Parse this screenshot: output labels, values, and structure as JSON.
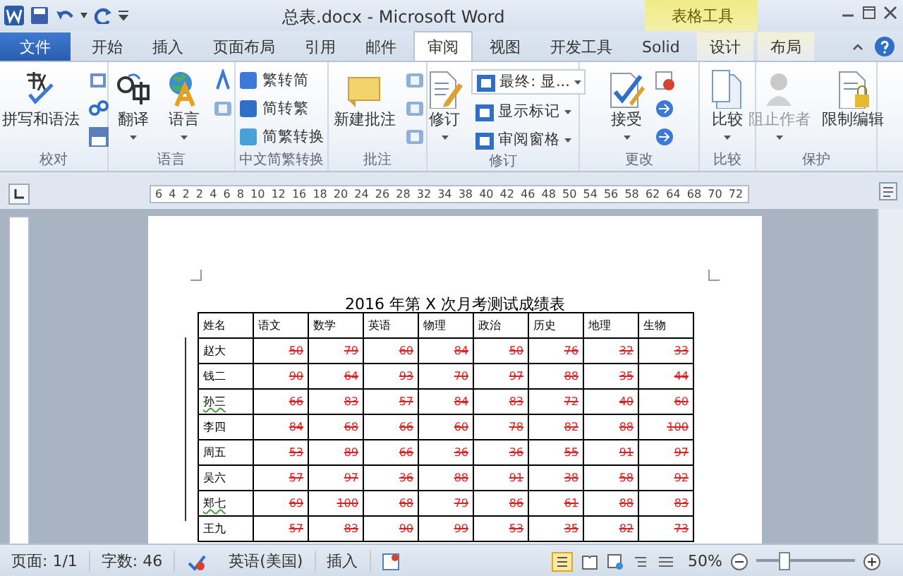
{
  "window": {
    "title": "总表.docx - Microsoft Word",
    "contextual_group": "表格工具"
  },
  "tabs": [
    {
      "label": "文件",
      "kind": "file",
      "selected": false
    },
    {
      "label": "开始",
      "kind": "normal",
      "selected": false
    },
    {
      "label": "插入",
      "kind": "normal",
      "selected": false
    },
    {
      "label": "页面布局",
      "kind": "normal",
      "selected": false
    },
    {
      "label": "引用",
      "kind": "normal",
      "selected": false
    },
    {
      "label": "邮件",
      "kind": "normal",
      "selected": false
    },
    {
      "label": "审阅",
      "kind": "normal",
      "selected": true
    },
    {
      "label": "视图",
      "kind": "normal",
      "selected": false
    },
    {
      "label": "开发工具",
      "kind": "normal",
      "selected": false
    },
    {
      "label": "Solid",
      "kind": "normal",
      "selected": false
    },
    {
      "label": "设计",
      "kind": "contextual",
      "selected": false
    },
    {
      "label": "布局",
      "kind": "contextual",
      "selected": false
    }
  ],
  "ribbon_groups": [
    {
      "title": "校对",
      "items": [
        {
          "kind": "large",
          "label": "拼写和语法",
          "dropdown": false,
          "disabled": false
        },
        {
          "kind": "icons"
        }
      ]
    },
    {
      "title": "语言",
      "items": [
        {
          "kind": "large",
          "label": "翻译",
          "dropdown": true,
          "disabled": false
        },
        {
          "kind": "large",
          "label": "语言",
          "dropdown": true,
          "disabled": false
        },
        {
          "kind": "icons"
        }
      ]
    },
    {
      "title": "中文简繁转换",
      "items": [
        {
          "kind": "smalls",
          "entries": [
            {
              "label": "繁转简",
              "dropdown": false
            },
            {
              "label": "简转繁",
              "dropdown": false
            },
            {
              "label": "简繁转换",
              "dropdown": false
            }
          ]
        }
      ]
    },
    {
      "title": "批注",
      "items": [
        {
          "kind": "large",
          "label": "新建批注",
          "dropdown": false,
          "disabled": false
        },
        {
          "kind": "icons"
        }
      ]
    },
    {
      "title": "修订",
      "items": [
        {
          "kind": "large",
          "label": "修订",
          "dropdown": true,
          "disabled": false
        },
        {
          "kind": "smalls",
          "entries": [
            {
              "label": "最终: 显...",
              "dropdown": true,
              "combo": true
            },
            {
              "label": "显示标记",
              "dropdown": true
            },
            {
              "label": "审阅窗格",
              "dropdown": true
            }
          ]
        }
      ]
    },
    {
      "title": "更改",
      "items": [
        {
          "kind": "large",
          "label": "接受",
          "dropdown": true,
          "disabled": false
        },
        {
          "kind": "icons"
        }
      ]
    },
    {
      "title": "比较",
      "items": [
        {
          "kind": "large",
          "label": "比较",
          "dropdown": true,
          "disabled": false
        }
      ]
    },
    {
      "title": "保护",
      "items": [
        {
          "kind": "large",
          "label": "阻止作者",
          "dropdown": true,
          "disabled": true
        },
        {
          "kind": "large",
          "label": "限制编辑",
          "dropdown": false,
          "disabled": false
        }
      ]
    }
  ],
  "ruler": {
    "labels": [
      "6",
      "4",
      "2",
      "2",
      "4",
      "6",
      "8",
      "10",
      "12",
      "16",
      "18",
      "20",
      "24",
      "26",
      "28",
      "32",
      "34",
      "38",
      "40",
      "42",
      "46",
      "48",
      "50",
      "54",
      "56",
      "58",
      "62",
      "64",
      "68",
      "70",
      "72"
    ]
  },
  "document": {
    "title": "2016 年第 X 次月考测试成绩表",
    "table": {
      "columns": [
        "姓名",
        "语文",
        "数学",
        "英语",
        "物理",
        "政治",
        "历史",
        "地理",
        "生物"
      ],
      "rows": [
        {
          "name": "赵大",
          "flagged": false,
          "deleted": true,
          "scores": [
            "50",
            "79",
            "60",
            "84",
            "50",
            "76",
            "32",
            "33"
          ]
        },
        {
          "name": "钱二",
          "flagged": false,
          "deleted": true,
          "scores": [
            "90",
            "64",
            "93",
            "70",
            "97",
            "88",
            "35",
            "44"
          ]
        },
        {
          "name": "孙三",
          "flagged": true,
          "deleted": true,
          "scores": [
            "66",
            "83",
            "57",
            "84",
            "83",
            "72",
            "40",
            "60"
          ]
        },
        {
          "name": "李四",
          "flagged": false,
          "deleted": true,
          "scores": [
            "84",
            "68",
            "66",
            "60",
            "78",
            "82",
            "88",
            "100"
          ]
        },
        {
          "name": "周五",
          "flagged": false,
          "deleted": true,
          "scores": [
            "53",
            "89",
            "66",
            "36",
            "36",
            "55",
            "91",
            "97"
          ]
        },
        {
          "name": "吴六",
          "flagged": false,
          "deleted": true,
          "scores": [
            "57",
            "97",
            "36",
            "88",
            "91",
            "38",
            "58",
            "92"
          ]
        },
        {
          "name": "郑七",
          "flagged": true,
          "deleted": true,
          "scores": [
            "69",
            "100",
            "68",
            "79",
            "86",
            "61",
            "88",
            "83"
          ]
        },
        {
          "name": "王九",
          "flagged": false,
          "deleted": true,
          "scores": [
            "57",
            "83",
            "90",
            "99",
            "53",
            "35",
            "82",
            "73"
          ]
        }
      ]
    }
  },
  "status_bar": {
    "page": "页面: 1/1",
    "words": "字数: 46",
    "language": "英语(美国)",
    "mode": "插入",
    "zoom": "50%",
    "zoom_slider": {
      "level": 0.25
    }
  }
}
